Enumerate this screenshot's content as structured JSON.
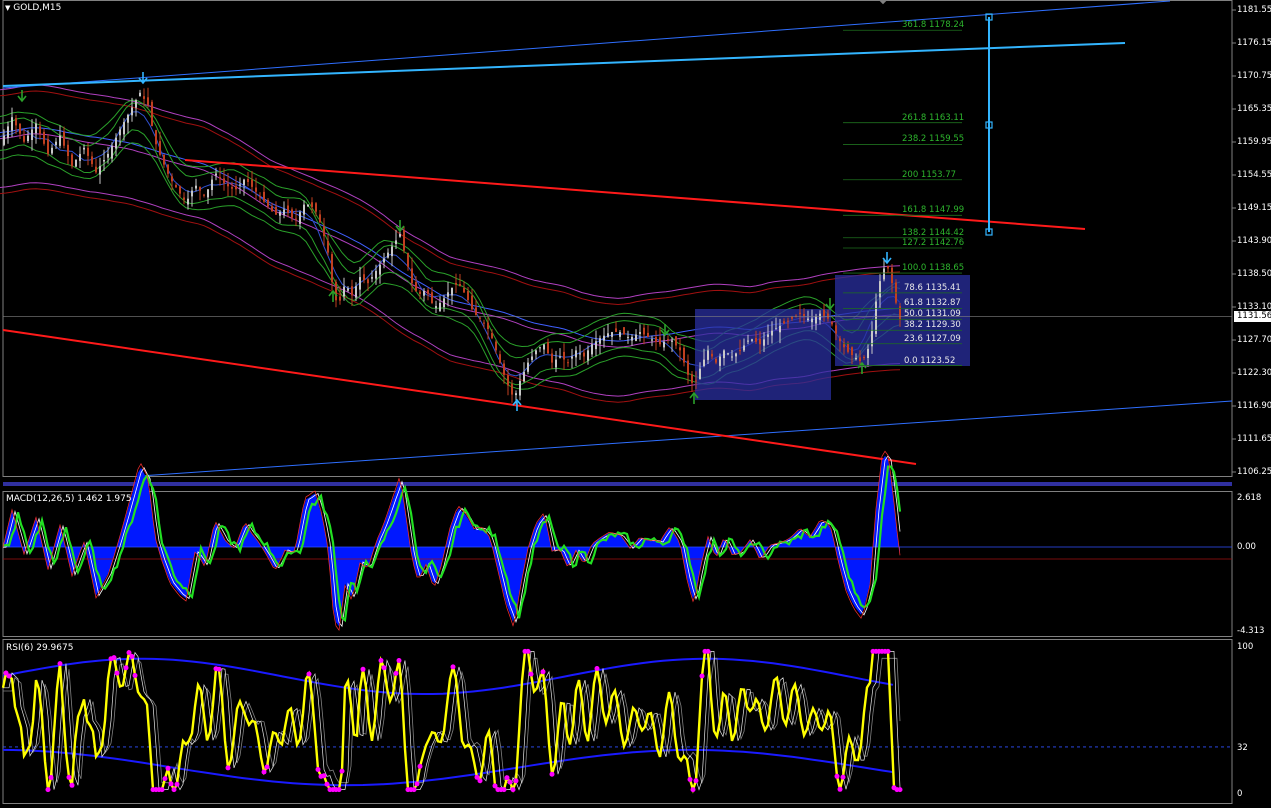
{
  "symbol_title": "GOLD,M15",
  "colors": {
    "background": "#000000",
    "bull_candle": "#c8c8c8",
    "bear_candle": "#c04020",
    "channel_line": "#2f6fff",
    "channel_bright": "#33b5ff",
    "trend_red": "#ff1a1a",
    "envelope_magenta": "#b040c0",
    "envelope_red": "#a01010",
    "bollinger_green": "#2aa02a",
    "fib_text": "#2db52d",
    "macd_fill": "#0018ff",
    "macd_signal": "#22e022",
    "rsi_main": "#ffff00",
    "rsi_dots": "#ff00ff",
    "box_fill": "#2a2fa0"
  },
  "current_price": "1131.56",
  "chart_data": [
    {
      "type": "line",
      "pane": "price",
      "title": "GOLD,M15",
      "y_ticks": [
        "1181.55",
        "1176.15",
        "1170.75",
        "1165.35",
        "1159.95",
        "1154.55",
        "1149.15",
        "1143.90",
        "1138.50",
        "1133.10",
        "1127.70",
        "1122.30",
        "1116.90",
        "1111.65",
        "1106.25"
      ],
      "ylim": [
        1104,
        1184
      ],
      "close_path": [
        [
          0,
          1159.5
        ],
        [
          12,
          1164
        ],
        [
          24,
          1160
        ],
        [
          36,
          1163
        ],
        [
          48,
          1158
        ],
        [
          60,
          1161
        ],
        [
          72,
          1156
        ],
        [
          84,
          1159
        ],
        [
          96,
          1155
        ],
        [
          108,
          1158
        ],
        [
          120,
          1162
        ],
        [
          130,
          1165
        ],
        [
          140,
          1168
        ],
        [
          148,
          1166
        ],
        [
          155,
          1160
        ],
        [
          162,
          1157
        ],
        [
          170,
          1154
        ],
        [
          178,
          1152
        ],
        [
          186,
          1150
        ],
        [
          195,
          1153
        ],
        [
          205,
          1151
        ],
        [
          215,
          1155
        ],
        [
          225,
          1153
        ],
        [
          235,
          1152
        ],
        [
          245,
          1154
        ],
        [
          255,
          1152
        ],
        [
          265,
          1150
        ],
        [
          275,
          1148
        ],
        [
          285,
          1149
        ],
        [
          295,
          1147
        ],
        [
          305,
          1150
        ],
        [
          315,
          1149
        ],
        [
          322,
          1146
        ],
        [
          328,
          1142
        ],
        [
          333,
          1136
        ],
        [
          338,
          1133
        ],
        [
          345,
          1137
        ],
        [
          352,
          1135
        ],
        [
          360,
          1138
        ],
        [
          368,
          1137
        ],
        [
          376,
          1139
        ],
        [
          384,
          1141
        ],
        [
          392,
          1143
        ],
        [
          400,
          1145
        ],
        [
          406,
          1141
        ],
        [
          412,
          1137
        ],
        [
          418,
          1135
        ],
        [
          426,
          1136
        ],
        [
          434,
          1133
        ],
        [
          442,
          1134
        ],
        [
          450,
          1136
        ],
        [
          458,
          1137
        ],
        [
          466,
          1135
        ],
        [
          474,
          1132
        ],
        [
          482,
          1131
        ],
        [
          490,
          1129
        ],
        [
          498,
          1125
        ],
        [
          506,
          1121
        ],
        [
          514,
          1118
        ],
        [
          520,
          1121
        ],
        [
          528,
          1124
        ],
        [
          536,
          1126
        ],
        [
          544,
          1127
        ],
        [
          552,
          1124
        ],
        [
          560,
          1125
        ],
        [
          568,
          1124
        ],
        [
          576,
          1126
        ],
        [
          584,
          1125
        ],
        [
          592,
          1127
        ],
        [
          600,
          1128
        ],
        [
          610,
          1129
        ],
        [
          620,
          1129
        ],
        [
          630,
          1128
        ],
        [
          640,
          1129
        ],
        [
          650,
          1128
        ],
        [
          660,
          1127
        ],
        [
          670,
          1128
        ],
        [
          680,
          1126
        ],
        [
          688,
          1122
        ],
        [
          694,
          1120
        ],
        [
          700,
          1123
        ],
        [
          708,
          1126
        ],
        [
          716,
          1124
        ],
        [
          724,
          1126
        ],
        [
          732,
          1125
        ],
        [
          740,
          1126
        ],
        [
          750,
          1128
        ],
        [
          760,
          1127
        ],
        [
          770,
          1129
        ],
        [
          780,
          1130
        ],
        [
          790,
          1131
        ],
        [
          800,
          1132
        ],
        [
          810,
          1131
        ],
        [
          820,
          1132
        ],
        [
          830,
          1131
        ],
        [
          838,
          1128
        ],
        [
          846,
          1126
        ],
        [
          854,
          1125
        ],
        [
          862,
          1124
        ],
        [
          870,
          1127
        ],
        [
          876,
          1134
        ],
        [
          882,
          1139
        ],
        [
          887,
          1140
        ],
        [
          892,
          1137
        ],
        [
          897,
          1133
        ],
        [
          900,
          1131
        ]
      ],
      "series_note_free": true
    },
    {
      "type": "line",
      "pane": "macd",
      "title": "MACD(12,26,5) 1.462 1.975",
      "y_ticks": [
        "2.618",
        "0.00",
        "-4.313"
      ],
      "ylim": [
        -4.6,
        2.9
      ],
      "zero": 0
    },
    {
      "type": "line",
      "pane": "rsi",
      "title": "RSI(6) 29.9675",
      "y_ticks": [
        "100",
        "32",
        "0"
      ],
      "ylim": [
        0,
        100
      ]
    }
  ],
  "fibonacci": [
    {
      "label": "361.8 1178.24",
      "price": 1178.24
    },
    {
      "label": "261.8 1163.11",
      "price": 1163.11
    },
    {
      "label": "238.2 1159.55",
      "price": 1159.55
    },
    {
      "label": "200 1153.77",
      "price": 1153.77
    },
    {
      "label": "161.8 1147.99",
      "price": 1147.99
    },
    {
      "label": "138.2 1144.42",
      "price": 1144.42
    },
    {
      "label": "127.2 1142.76",
      "price": 1142.76
    },
    {
      "label": "100.0 1138.65",
      "price": 1138.65
    },
    {
      "label": "78.6 1135.41",
      "price": 1135.41
    },
    {
      "label": "61.8 1132.87",
      "price": 1132.87
    },
    {
      "label": "50.0 1131.09",
      "price": 1131.09
    },
    {
      "label": "38.2 1129.30",
      "price": 1129.3
    },
    {
      "label": "23.6 1127.09",
      "price": 1127.09
    },
    {
      "label": "0.0 1123.52",
      "price": 1123.52
    }
  ]
}
